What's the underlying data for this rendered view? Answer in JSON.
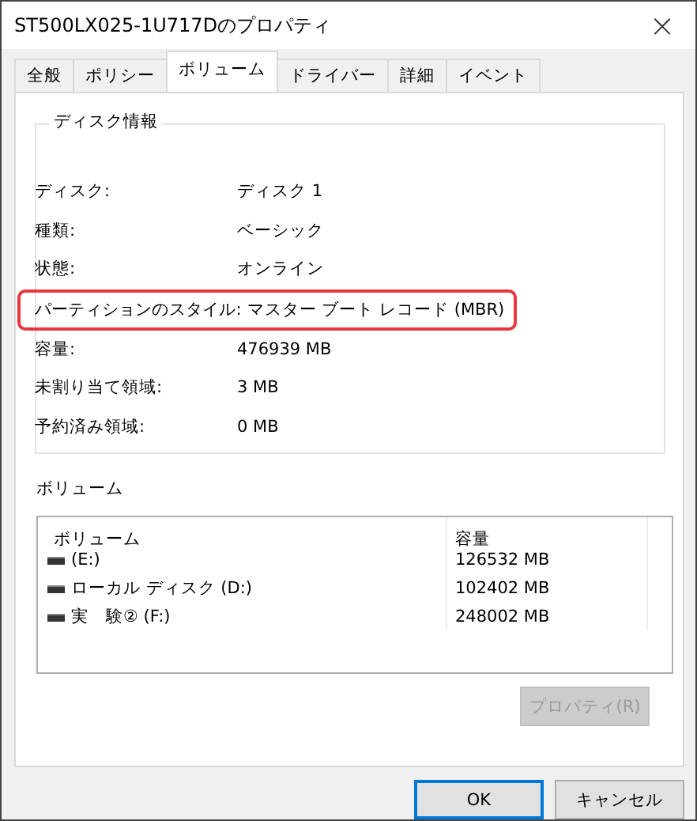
{
  "window": {
    "title": "ST500LX025-1U717Dのプロパティ",
    "close": "×"
  },
  "tabs": [
    {
      "label": "全般",
      "selected": false
    },
    {
      "label": "ポリシー",
      "selected": false
    },
    {
      "label": "ボリューム",
      "selected": true
    },
    {
      "label": "ドライバー",
      "selected": false
    },
    {
      "label": "詳細",
      "selected": false
    },
    {
      "label": "イベント",
      "selected": false
    }
  ],
  "disk_info": {
    "title": "ディスク情報",
    "rows": [
      {
        "label": "ディスク:",
        "value": "ディスク 1",
        "highlighted": false
      },
      {
        "label": "種類:",
        "value": "ベーシック",
        "highlighted": false
      },
      {
        "label": "状態:",
        "value": "オンライン",
        "highlighted": false
      },
      {
        "label": "パーティションのスタイル:",
        "value": "マスター ブート レコード (MBR)",
        "highlighted": true
      },
      {
        "label": "容量:",
        "value": "476939 MB",
        "highlighted": false
      },
      {
        "label": "未割り当て領域:",
        "value": "3 MB",
        "highlighted": false
      },
      {
        "label": "予約済み領域:",
        "value": "0 MB",
        "highlighted": false
      }
    ]
  },
  "volumes": {
    "title": "ボリューム",
    "columns": [
      "ボリューム",
      "容量"
    ],
    "rows": [
      {
        "name": "(E:)",
        "capacity": "126532 MB"
      },
      {
        "name": "ローカル ディスク (D:)",
        "capacity": "102402 MB"
      },
      {
        "name": "実　験② (F:)",
        "capacity": "248002 MB"
      }
    ],
    "button": {
      "label": "プロパティ(R)",
      "disabled": true
    }
  },
  "buttons": [
    {
      "label": "OK",
      "default": true
    },
    {
      "label": "キャンセル",
      "default": false
    }
  ]
}
